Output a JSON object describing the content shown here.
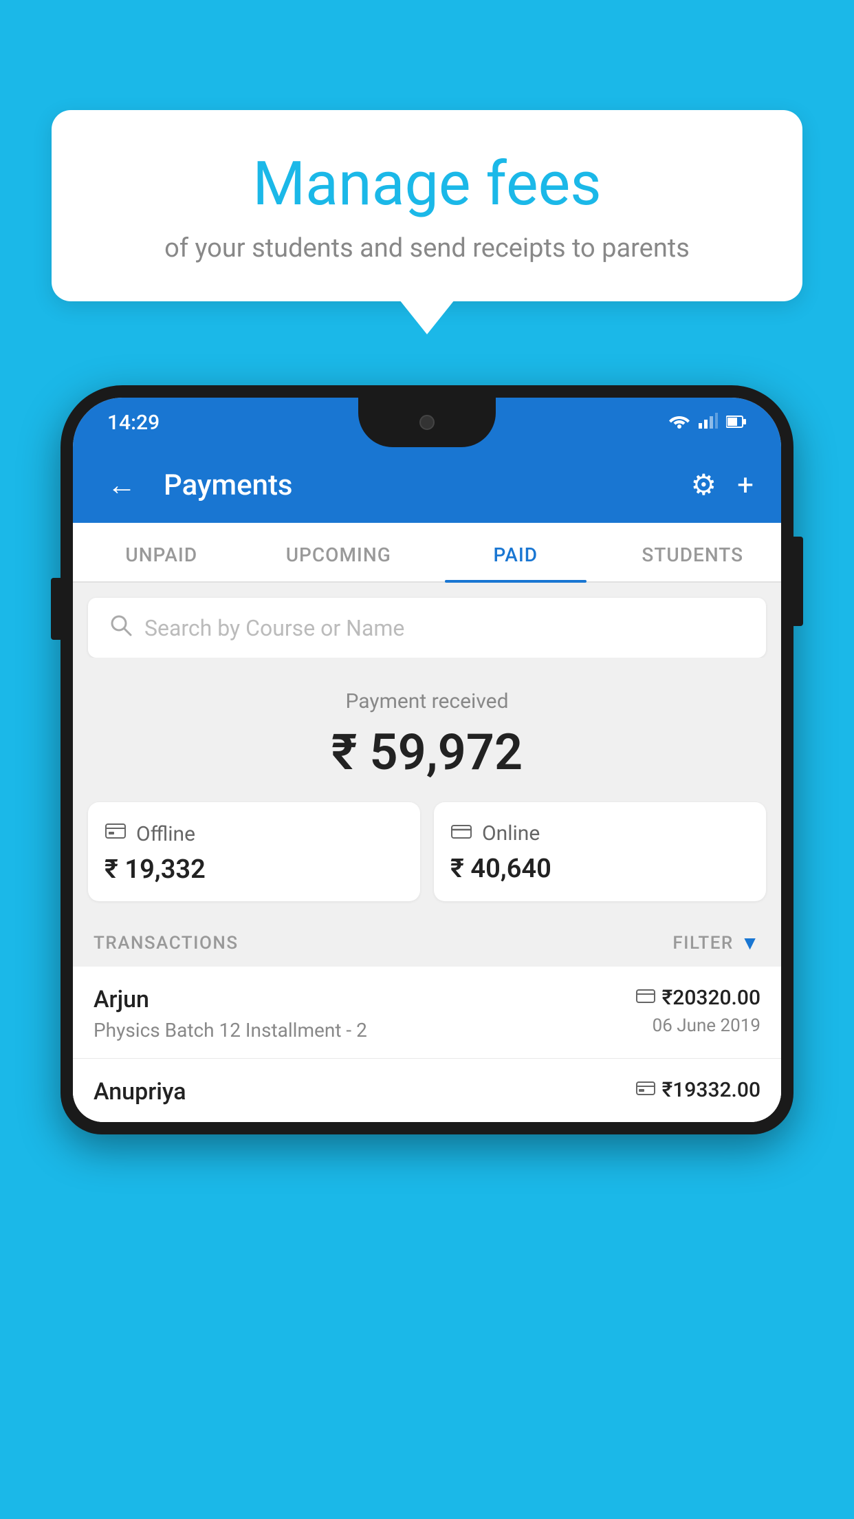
{
  "background_color": "#1BB8E8",
  "speech_bubble": {
    "title": "Manage fees",
    "subtitle": "of your students and send receipts to parents"
  },
  "phone": {
    "status_bar": {
      "time": "14:29",
      "wifi_icon": "▼",
      "signal_icon": "▲",
      "battery_icon": "▐"
    },
    "app_bar": {
      "title": "Payments",
      "back_icon": "←",
      "gear_icon": "⚙",
      "plus_icon": "+"
    },
    "tabs": [
      {
        "label": "UNPAID",
        "active": false
      },
      {
        "label": "UPCOMING",
        "active": false
      },
      {
        "label": "PAID",
        "active": true
      },
      {
        "label": "STUDENTS",
        "active": false
      }
    ],
    "search": {
      "placeholder": "Search by Course or Name",
      "icon": "🔍"
    },
    "payment_summary": {
      "label": "Payment received",
      "amount": "₹ 59,972",
      "offline_label": "Offline",
      "offline_amount": "₹ 19,332",
      "online_label": "Online",
      "online_amount": "₹ 40,640"
    },
    "transactions": {
      "header_label": "TRANSACTIONS",
      "filter_label": "FILTER",
      "items": [
        {
          "name": "Arjun",
          "course": "Physics Batch 12 Installment - 2",
          "amount": "₹20320.00",
          "date": "06 June 2019",
          "payment_type": "card"
        },
        {
          "name": "Anupriya",
          "course": "",
          "amount": "₹19332.00",
          "date": "",
          "payment_type": "offline"
        }
      ]
    }
  }
}
